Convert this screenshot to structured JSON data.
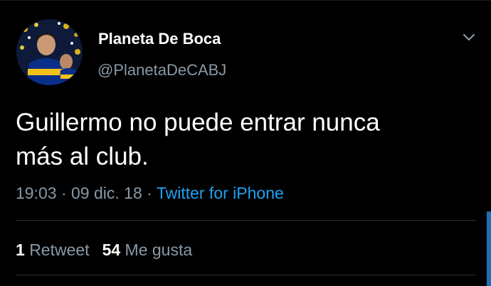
{
  "tweet": {
    "display_name": "Planeta De Boca",
    "handle": "@PlanetaDeCABJ",
    "text_lines": [
      "Guillermo no puede entrar nunca",
      "más al club."
    ],
    "time": "19:03",
    "date": "09 dic. 18",
    "separator": "·",
    "source": "Twitter for iPhone",
    "retweets_count": "1",
    "retweets_label": "Retweet",
    "likes_count": "54",
    "likes_label": "Me gusta"
  },
  "icons": {
    "menu": "chevron-down-icon"
  },
  "colors": {
    "background": "#000000",
    "text_primary": "#ffffff",
    "text_secondary": "#8899a6",
    "link": "#1da1f2",
    "divider": "#26313b",
    "scrollbar": "#1f6fb3"
  }
}
